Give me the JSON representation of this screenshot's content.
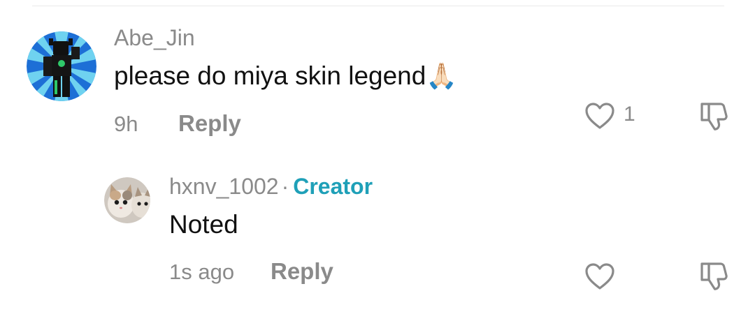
{
  "comments": [
    {
      "username": "Abe_Jin",
      "text": "please do miya skin legend",
      "emoji": "🙏🏻",
      "time": "9h",
      "reply_label": "Reply",
      "like_count": "1",
      "avatar_icon": "roblox-character-avatar"
    },
    {
      "username": "hxnv_1002",
      "separator": "·",
      "badge": "Creator",
      "text": "Noted",
      "time": "1s ago",
      "reply_label": "Reply",
      "avatar_icon": "cat-photo-avatar"
    }
  ],
  "colors": {
    "muted": "#8a8a8a",
    "creator": "#1fa0b8",
    "text": "#111111"
  }
}
